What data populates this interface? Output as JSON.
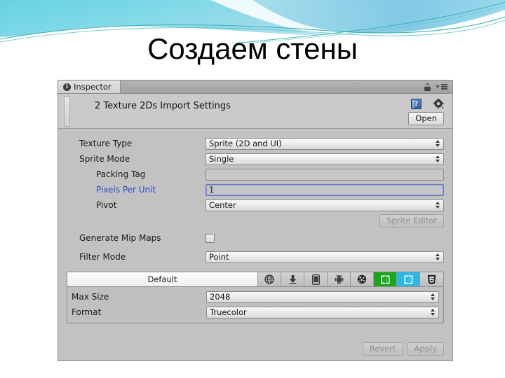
{
  "slide": {
    "title": "Создаем стены",
    "header_colors": {
      "cyan_light": "#a9e5ef",
      "cyan_mid": "#5fc8dd",
      "teal_line": "#2a9d9d",
      "blue_tint": "#7fc6e4"
    }
  },
  "inspector": {
    "tab": {
      "label": "Inspector",
      "icon": "info-icon"
    },
    "tabstrip_icons": [
      "lock-icon",
      "menu-dropdown-icon"
    ],
    "object_header": {
      "title": "2 Texture 2Ds Import Settings",
      "help_icon": "help-book-icon",
      "gear_icon": "gear-icon",
      "open_button": "Open"
    },
    "properties": [
      {
        "label": "Texture Type",
        "control": "popup",
        "value": "Sprite (2D and UI)",
        "indent": false,
        "blue": false
      },
      {
        "label": "Sprite Mode",
        "control": "popup",
        "value": "Single",
        "indent": false,
        "blue": false
      },
      {
        "label": "Packing Tag",
        "control": "text",
        "value": "",
        "indent": true,
        "blue": false
      },
      {
        "label": "Pixels Per Unit",
        "control": "text",
        "value": "1",
        "indent": true,
        "blue": true,
        "focused": true
      },
      {
        "label": "Pivot",
        "control": "popup",
        "value": "Center",
        "indent": true,
        "blue": false
      }
    ],
    "sprite_editor_button": "Sprite Editor",
    "generate_mip_maps": {
      "label": "Generate Mip Maps",
      "checked": false
    },
    "filter_mode": {
      "label": "Filter Mode",
      "value": "Point"
    },
    "platform_tabs": [
      {
        "name": "Default",
        "label": "Default",
        "icon": "text",
        "selected": true
      },
      {
        "name": "Standalone",
        "label": "",
        "icon": "globe-icon",
        "selected": false
      },
      {
        "name": "WebPlayer",
        "label": "",
        "icon": "download-arrow-icon",
        "selected": false
      },
      {
        "name": "iOS",
        "label": "",
        "icon": "phone-icon",
        "selected": false
      },
      {
        "name": "Android",
        "label": "",
        "icon": "android-icon",
        "selected": false
      },
      {
        "name": "Tizen",
        "label": "",
        "icon": "tizen-globe-icon",
        "selected": false
      },
      {
        "name": "WindowsStore",
        "label": "",
        "icon": "windows-store-icon",
        "selected": false
      },
      {
        "name": "WindowsPhone",
        "label": "",
        "icon": "windows-phone-icon",
        "selected": false
      },
      {
        "name": "WebGL",
        "label": "",
        "icon": "html5-icon",
        "selected": false
      }
    ],
    "platform_settings": [
      {
        "label": "Max Size",
        "value": "2048"
      },
      {
        "label": "Format",
        "value": "Truecolor"
      }
    ],
    "footer": {
      "revert": "Revert",
      "apply": "Apply"
    }
  }
}
